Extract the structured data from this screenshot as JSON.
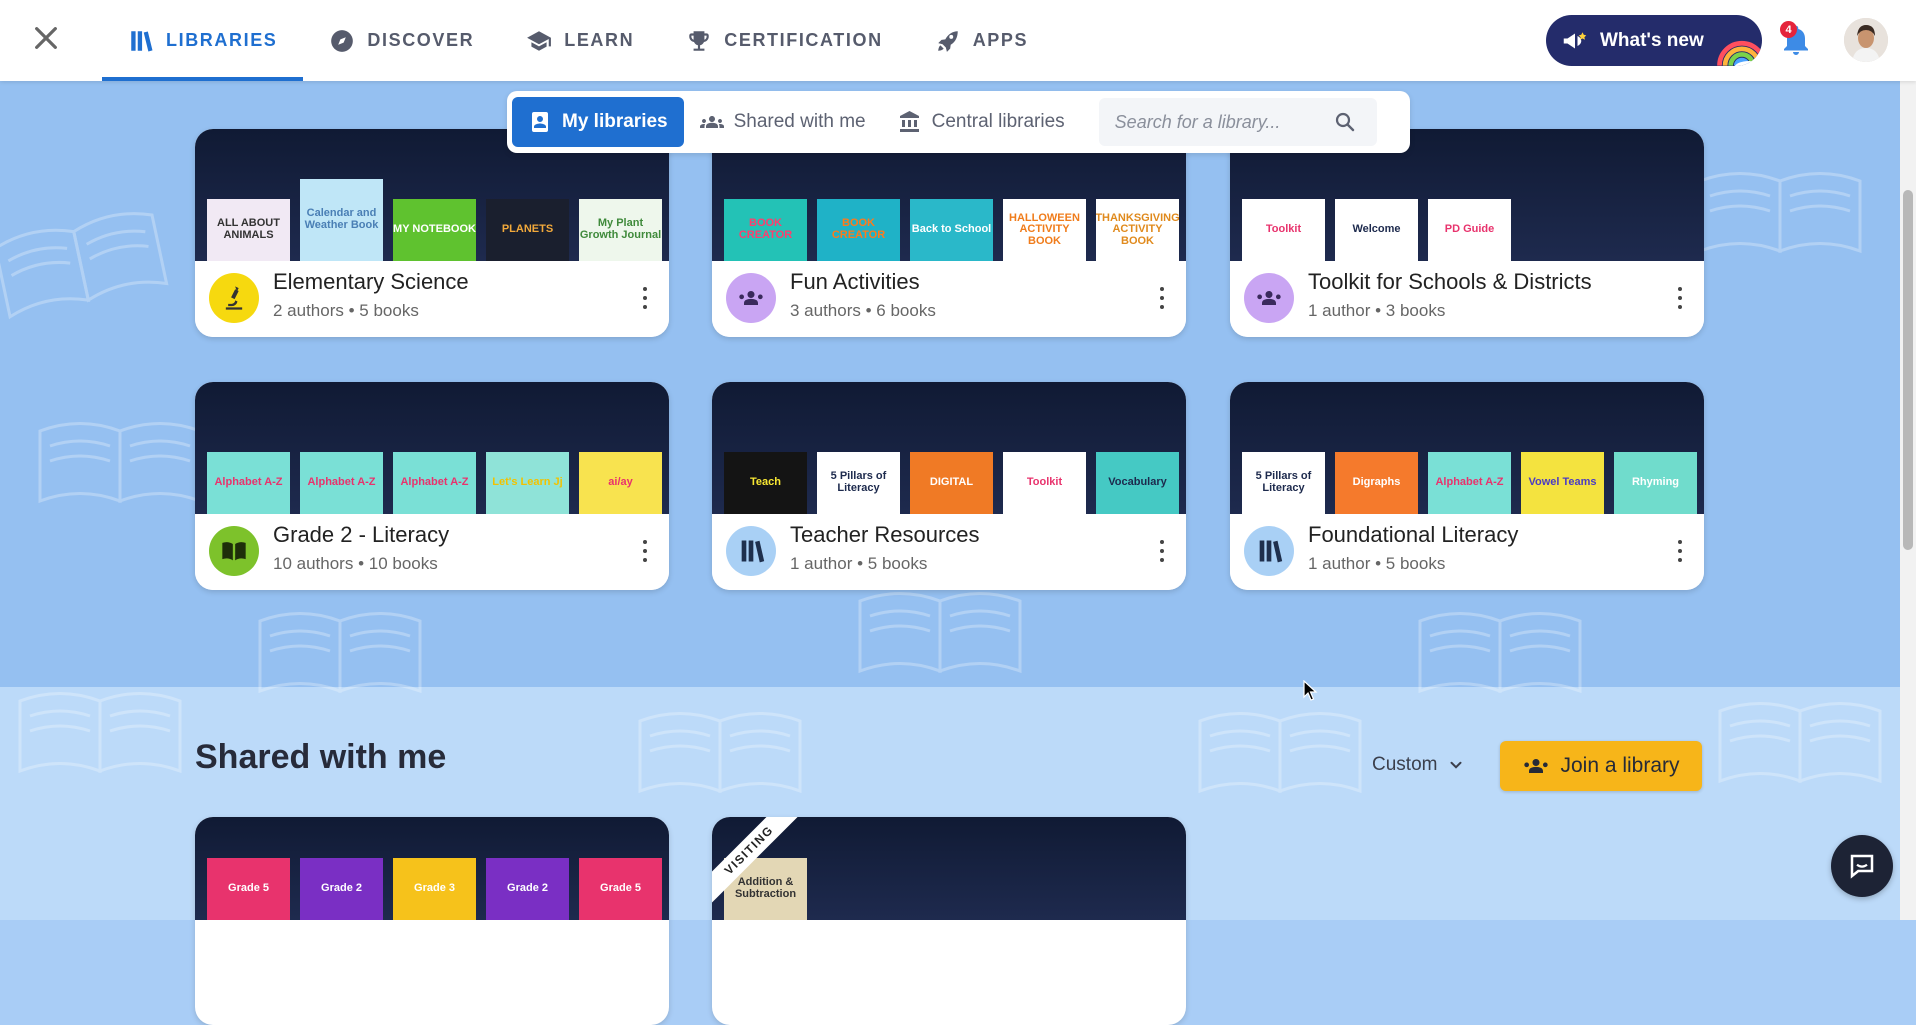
{
  "nav": {
    "items": [
      {
        "label": "LIBRARIES",
        "icon": "libraries-icon",
        "active": true
      },
      {
        "label": "DISCOVER",
        "icon": "compass-icon",
        "active": false
      },
      {
        "label": "LEARN",
        "icon": "graduation-cap-icon",
        "active": false
      },
      {
        "label": "CERTIFICATION",
        "icon": "trophy-icon",
        "active": false
      },
      {
        "label": "APPS",
        "icon": "rocket-icon",
        "active": false
      }
    ],
    "whats_new": "What's new",
    "notification_count": "4"
  },
  "library_tabs": {
    "my_libraries": "My libraries",
    "shared_with_me": "Shared with me",
    "central_libraries": "Central libraries",
    "search_placeholder": "Search for a library..."
  },
  "libraries": [
    {
      "name": "Elementary Science",
      "authors": "2 authors",
      "books": "5 books",
      "icon": "microscope-icon",
      "icon_color": "#f6d90f",
      "covers": [
        {
          "text": "ALL ABOUT ANIMALS",
          "bg": "#f1e9f4",
          "fg": "#333333"
        },
        {
          "text": "Calendar and Weather Book",
          "bg": "#bfe6f7",
          "fg": "#4a7fb5"
        },
        {
          "text": "MY NOTEBOOK",
          "bg": "#5fc22f",
          "fg": "#ffffff"
        },
        {
          "text": "PLANETS",
          "bg": "#1a1f2e",
          "fg": "#f2a93b"
        },
        {
          "text": "My Plant Growth Journal",
          "bg": "#eef7ec",
          "fg": "#3f8a3b"
        }
      ]
    },
    {
      "name": "Fun Activities",
      "authors": "3 authors",
      "books": "6 books",
      "icon": "people-group-icon",
      "icon_color": "#c9a5f3",
      "covers": [
        {
          "text": "BOOK CREATOR",
          "bg": "#23c2b6",
          "fg": "#ff3d6e"
        },
        {
          "text": "BOOK CREATOR",
          "bg": "#1fb2c7",
          "fg": "#ff7a1a"
        },
        {
          "text": "Back to School",
          "bg": "#2ab8c9",
          "fg": "#ffffff"
        },
        {
          "text": "HALLOWEEN ACTIVITY BOOK",
          "bg": "#ffffff",
          "fg": "#f07c1b"
        },
        {
          "text": "THANKSGIVING ACTIVITY BOOK",
          "bg": "#ffffff",
          "fg": "#e08a1d"
        }
      ]
    },
    {
      "name": "Toolkit for Schools & Districts",
      "authors": "1 author",
      "books": "3 books",
      "icon": "people-group-icon",
      "icon_color": "#c9a5f3",
      "covers": [
        {
          "text": "Toolkit",
          "bg": "#ffffff",
          "fg": "#e8336d"
        },
        {
          "text": "Welcome",
          "bg": "#ffffff",
          "fg": "#1d2a4d"
        },
        {
          "text": "PD Guide",
          "bg": "#ffffff",
          "fg": "#e8336d"
        }
      ]
    },
    {
      "name": "Grade 2 - Literacy",
      "authors": "10 authors",
      "books": "10 books",
      "icon": "open-book-icon",
      "icon_color": "#7dc22b",
      "covers": [
        {
          "text": "Alphabet A-Z",
          "bg": "#7ae0d6",
          "fg": "#e8336d"
        },
        {
          "text": "Alphabet A-Z",
          "bg": "#7ae0d6",
          "fg": "#e8336d"
        },
        {
          "text": "Alphabet A-Z",
          "bg": "#7ae0d6",
          "fg": "#e8336d"
        },
        {
          "text": "Let's Learn Jj",
          "bg": "#8fe3d8",
          "fg": "#f2c200"
        },
        {
          "text": "ai/ay",
          "bg": "#f8e34f",
          "fg": "#e8336d"
        }
      ]
    },
    {
      "name": "Teacher Resources",
      "authors": "1 author",
      "books": "5 books",
      "icon": "library-books-icon",
      "icon_color": "#a9d0f5",
      "covers": [
        {
          "text": "Teach",
          "bg": "#141414",
          "fg": "#f7e733"
        },
        {
          "text": "5 Pillars of Literacy",
          "bg": "#ffffff",
          "fg": "#1d2a4d"
        },
        {
          "text": "DIGITAL",
          "bg": "#f07a25",
          "fg": "#ffffff"
        },
        {
          "text": "Toolkit",
          "bg": "#ffffff",
          "fg": "#e8336d"
        },
        {
          "text": "Vocabulary",
          "bg": "#45c9c4",
          "fg": "#1d2a4d"
        }
      ]
    },
    {
      "name": "Foundational Literacy",
      "authors": "1 author",
      "books": "5 books",
      "icon": "library-books-icon",
      "icon_color": "#a9d0f5",
      "covers": [
        {
          "text": "5 Pillars of Literacy",
          "bg": "#ffffff",
          "fg": "#1d2a4d"
        },
        {
          "text": "Digraphs",
          "bg": "#f57a2c",
          "fg": "#ffffff"
        },
        {
          "text": "Alphabet A-Z",
          "bg": "#7ae0d6",
          "fg": "#e8336d"
        },
        {
          "text": "Vowel Teams",
          "bg": "#f4e33f",
          "fg": "#4a3bc4"
        },
        {
          "text": "Rhyming",
          "bg": "#70dccc",
          "fg": "#ffffff"
        }
      ]
    }
  ],
  "shared": {
    "title": "Shared with me",
    "sort_label": "Custom",
    "join_button": "Join a library",
    "cards": [
      {
        "covers": [
          {
            "text": "Grade 5",
            "bg": "#e8336d",
            "fg": "#ffffff"
          },
          {
            "text": "Grade 2",
            "bg": "#7a2fc4",
            "fg": "#ffffff"
          },
          {
            "text": "Grade 3",
            "bg": "#f6c21b",
            "fg": "#ffffff"
          },
          {
            "text": "Grade 2",
            "bg": "#7a2fc4",
            "fg": "#ffffff"
          },
          {
            "text": "Grade 5",
            "bg": "#e8336d",
            "fg": "#ffffff"
          }
        ]
      },
      {
        "ribbon": "VISITING",
        "covers": [
          {
            "text": "Addition & Subtraction",
            "bg": "#e3d7b5",
            "fg": "#333333"
          }
        ]
      }
    ]
  }
}
